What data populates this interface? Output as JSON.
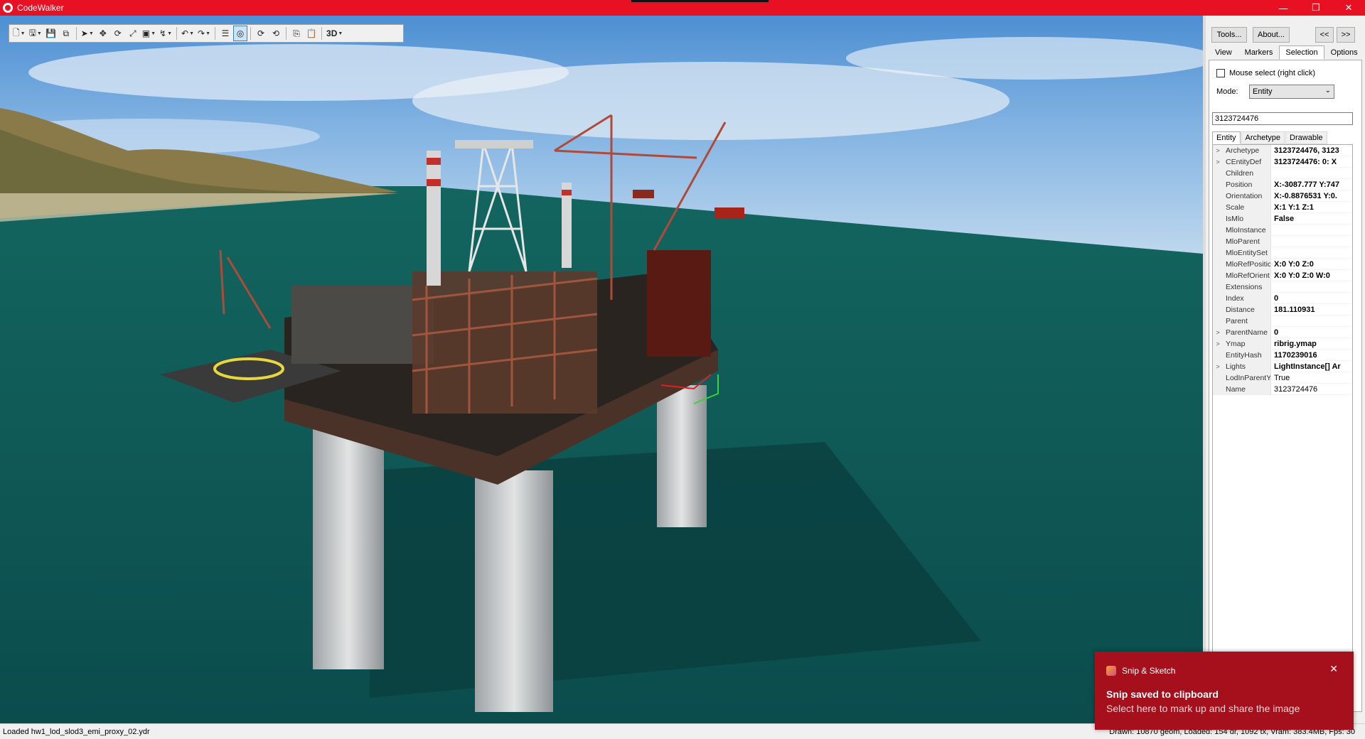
{
  "window": {
    "title": "CodeWalker",
    "min_icon": "minimize-icon",
    "max_icon": "restore-icon",
    "close_icon": "close-icon"
  },
  "toolbar": {
    "buttons": [
      "new-icon",
      "open-icon",
      "save-icon",
      "save-all-icon",
      "select-icon",
      "move-icon",
      "rotate-icon",
      "scale-icon",
      "snap-icon",
      "path-icon",
      "undo-icon",
      "redo-icon",
      "info-icon",
      "camera-icon",
      "rotate-cw-icon",
      "rotate-ccw-icon",
      "copy-icon",
      "paste-icon"
    ],
    "view_mode_label": "3D"
  },
  "panel": {
    "tools_label": "Tools...",
    "about_label": "About...",
    "collapse_label": "<<",
    "expand_label": ">>",
    "tabs": [
      "View",
      "Markers",
      "Selection",
      "Options"
    ],
    "active_tab": "Selection",
    "mouse_select_label": "Mouse select (right click)",
    "mouse_select_checked": false,
    "mode_label": "Mode:",
    "mode_value": "Entity",
    "search_value": "3123724476",
    "subtabs": [
      "Entity",
      "Archetype",
      "Drawable"
    ],
    "active_subtab": "Entity",
    "properties": [
      {
        "exp": ">",
        "name": "Archetype",
        "value": "3123724476, 3123",
        "bold": true
      },
      {
        "exp": ">",
        "name": "CEntityDef",
        "value": "3123724476: 0: X",
        "bold": true
      },
      {
        "exp": "",
        "name": "Children",
        "value": "",
        "bold": false
      },
      {
        "exp": "",
        "name": "Position",
        "value": "X:-3087.777 Y:747",
        "bold": true
      },
      {
        "exp": "",
        "name": "Orientation",
        "value": "X:-0.8876531 Y:0.",
        "bold": true
      },
      {
        "exp": "",
        "name": "Scale",
        "value": "X:1 Y:1 Z:1",
        "bold": true
      },
      {
        "exp": "",
        "name": "IsMlo",
        "value": "False",
        "bold": true
      },
      {
        "exp": "",
        "name": "MloInstance",
        "value": "",
        "bold": false
      },
      {
        "exp": "",
        "name": "MloParent",
        "value": "",
        "bold": false
      },
      {
        "exp": "",
        "name": "MloEntitySet",
        "value": "",
        "bold": false
      },
      {
        "exp": "",
        "name": "MloRefPositic",
        "value": "X:0 Y:0 Z:0",
        "bold": true
      },
      {
        "exp": "",
        "name": "MloRefOrient",
        "value": "X:0 Y:0 Z:0 W:0",
        "bold": true
      },
      {
        "exp": "",
        "name": "Extensions",
        "value": "",
        "bold": false
      },
      {
        "exp": "",
        "name": "Index",
        "value": "0",
        "bold": true
      },
      {
        "exp": "",
        "name": "Distance",
        "value": "181.110931",
        "bold": true
      },
      {
        "exp": "",
        "name": "Parent",
        "value": "",
        "bold": false
      },
      {
        "exp": ">",
        "name": "ParentName",
        "value": "0",
        "bold": true
      },
      {
        "exp": ">",
        "name": "Ymap",
        "value": "ribrig.ymap",
        "bold": true
      },
      {
        "exp": "",
        "name": "EntityHash",
        "value": "1170239016",
        "bold": true
      },
      {
        "exp": ">",
        "name": "Lights",
        "value": "LightInstance[] Ar",
        "bold": true
      },
      {
        "exp": "",
        "name": "LodInParentY",
        "value": "True",
        "bold": false
      },
      {
        "exp": "",
        "name": "Name",
        "value": "3123724476",
        "bold": false
      }
    ]
  },
  "status": {
    "left": "Loaded hw1_lod_slod3_emi_proxy_02.ydr",
    "right": "Drawn: 10870 geom, Loaded: 154 dr, 1092 tx, Vram: 383.4MB, Fps: 30"
  },
  "toast": {
    "app": "Snip & Sketch",
    "title": "Snip saved to clipboard",
    "body": "Select here to mark up and share the image",
    "close_icon": "close-icon"
  },
  "colors": {
    "titlebar": "#e81123",
    "toast": "#a5101c",
    "water": "#0f5a58"
  }
}
